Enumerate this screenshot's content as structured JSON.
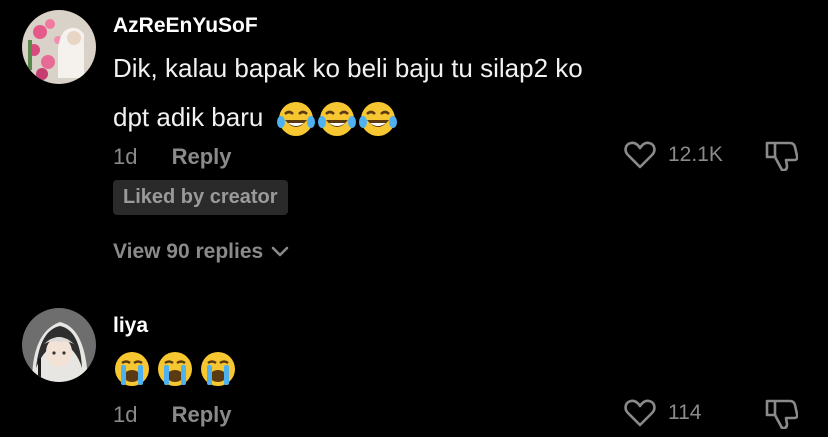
{
  "comments": [
    {
      "username": "AzReEnYuSoF",
      "text_line1": "Dik, kalau bapak ko beli baju tu silap2 ko",
      "text_line2": "dpt adik baru",
      "emoji": "laughing-tears-emoji",
      "time": "1d",
      "reply_label": "Reply",
      "likes": "12.1K",
      "badge": "Liked by creator",
      "view_replies": "View 90 replies"
    },
    {
      "username": "liya",
      "emoji": "crying-emoji",
      "time": "1d",
      "reply_label": "Reply",
      "likes": "114"
    }
  ],
  "colors": {
    "background": "#000000",
    "muted": "#8a8a8a",
    "badge_bg": "#2a2a2a"
  }
}
